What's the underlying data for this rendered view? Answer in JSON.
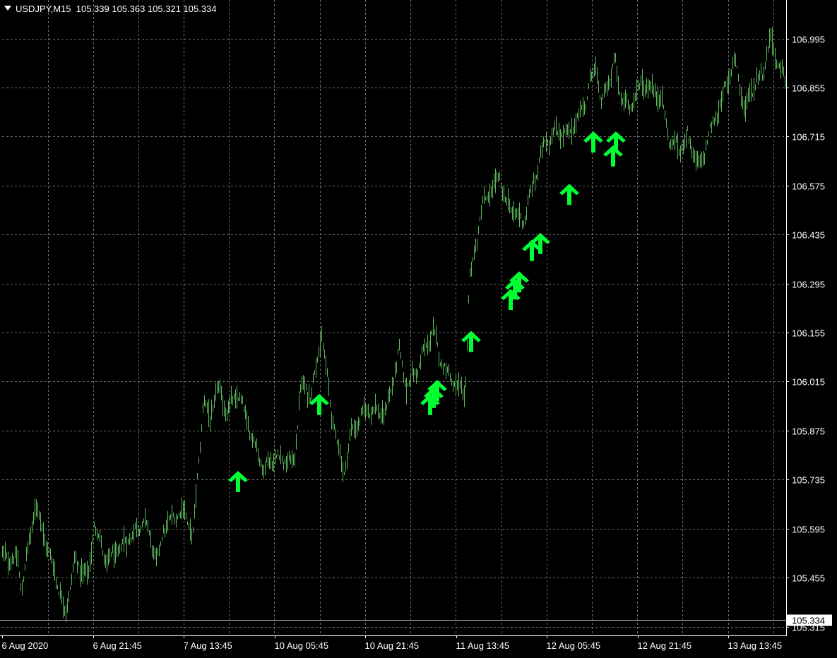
{
  "header": {
    "symbol": "USDJPY,M15",
    "ohlc": "105.339 105.363 105.321 105.334"
  },
  "colors": {
    "background": "#000000",
    "grid": "#6e6e6e",
    "bars": "#5cb85c",
    "arrows": "#00ff33",
    "text": "#ffffff"
  },
  "chart_data": {
    "type": "bar",
    "ylim": [
      105.29,
      107.105
    ],
    "y_ticks": [
      "106.995",
      "106.855",
      "106.715",
      "106.575",
      "106.435",
      "106.295",
      "106.155",
      "106.015",
      "105.875",
      "105.735",
      "105.595",
      "105.455",
      "105.315"
    ],
    "x_ticks": [
      "6 Aug 2020",
      "6 Aug 21:45",
      "7 Aug 13:45",
      "10 Aug 05:45",
      "10 Aug 21:45",
      "11 Aug 13:45",
      "12 Aug 05:45",
      "12 Aug 21:45",
      "13 Aug 13:45"
    ],
    "current_price": "105.334",
    "grid": true,
    "series": [
      {
        "price_path": [
          [
            0,
            105.52
          ],
          [
            25,
            105.5
          ],
          [
            30,
            105.42
          ],
          [
            50,
            105.67
          ],
          [
            68,
            105.53
          ],
          [
            80,
            105.45
          ],
          [
            92,
            105.35
          ],
          [
            105,
            105.5
          ],
          [
            125,
            105.46
          ],
          [
            133,
            105.61
          ],
          [
            150,
            105.5
          ],
          [
            170,
            105.54
          ],
          [
            205,
            105.62
          ],
          [
            222,
            105.5
          ],
          [
            232,
            105.6
          ],
          [
            258,
            105.65
          ],
          [
            273,
            105.58
          ],
          [
            288,
            105.97
          ],
          [
            297,
            105.9
          ],
          [
            307,
            106.0
          ],
          [
            320,
            105.93
          ],
          [
            337,
            105.98
          ],
          [
            356,
            105.86
          ],
          [
            372,
            105.77
          ],
          [
            392,
            105.8
          ],
          [
            416,
            105.78
          ],
          [
            425,
            106.0
          ],
          [
            440,
            105.98
          ],
          [
            455,
            106.15
          ],
          [
            468,
            105.94
          ],
          [
            486,
            105.75
          ],
          [
            497,
            105.87
          ],
          [
            520,
            105.94
          ],
          [
            545,
            105.92
          ],
          [
            565,
            106.1
          ],
          [
            575,
            106.0
          ],
          [
            590,
            106.05
          ],
          [
            612,
            106.16
          ],
          [
            625,
            106.07
          ],
          [
            640,
            106.02
          ],
          [
            658,
            105.97
          ],
          [
            664,
            106.3
          ],
          [
            683,
            106.52
          ],
          [
            707,
            106.6
          ],
          [
            715,
            106.53
          ],
          [
            740,
            106.47
          ],
          [
            755,
            106.58
          ],
          [
            770,
            106.7
          ],
          [
            790,
            106.73
          ],
          [
            805,
            106.72
          ],
          [
            828,
            106.81
          ],
          [
            843,
            106.93
          ],
          [
            850,
            106.8
          ],
          [
            870,
            106.93
          ],
          [
            878,
            106.83
          ],
          [
            892,
            106.8
          ],
          [
            908,
            106.87
          ],
          [
            935,
            106.83
          ],
          [
            948,
            106.7
          ],
          [
            962,
            106.68
          ],
          [
            973,
            106.72
          ],
          [
            990,
            106.62
          ],
          [
            1000,
            106.7
          ],
          [
            1018,
            106.8
          ],
          [
            1040,
            106.94
          ],
          [
            1055,
            106.78
          ],
          [
            1060,
            106.84
          ],
          [
            1080,
            106.9
          ],
          [
            1090,
            107.0
          ],
          [
            1100,
            106.93
          ],
          [
            1112,
            106.87
          ]
        ]
      }
    ],
    "signals": [
      {
        "x": 337,
        "price": 105.76
      },
      {
        "x": 452,
        "price": 105.98
      },
      {
        "x": 609,
        "price": 105.98
      },
      {
        "x": 614,
        "price": 106.0
      },
      {
        "x": 619,
        "price": 106.02
      },
      {
        "x": 667,
        "price": 106.16
      },
      {
        "x": 723,
        "price": 106.28
      },
      {
        "x": 729,
        "price": 106.31
      },
      {
        "x": 735,
        "price": 106.33
      },
      {
        "x": 753,
        "price": 106.42
      },
      {
        "x": 765,
        "price": 106.44
      },
      {
        "x": 806,
        "price": 106.58
      },
      {
        "x": 840,
        "price": 106.73
      },
      {
        "x": 868,
        "price": 106.69
      },
      {
        "x": 872,
        "price": 106.73
      }
    ]
  }
}
